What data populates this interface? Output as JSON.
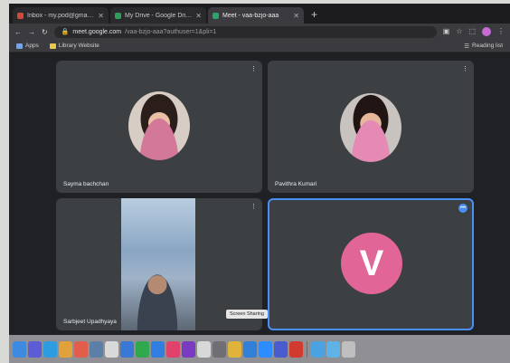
{
  "browser": {
    "tabs": [
      {
        "label": "Inbox - my.pod@gmail.com",
        "color": "#d14b3c",
        "active": false
      },
      {
        "label": "My Drive - Google Drive",
        "color": "#2f9e5b",
        "active": false
      },
      {
        "label": "Meet - vaa-bzjo-aaa",
        "color": "#2ba36a",
        "active": true
      }
    ],
    "new_tab_label": "+",
    "url": "meet.google.com",
    "url_rest": "/vaa-bzjo-aaa?authuser=1&pli=1",
    "bookmarks": [
      {
        "label": "Apps"
      },
      {
        "label": "Library Website"
      }
    ],
    "bookmarks_right": "Reading list"
  },
  "meet": {
    "accent": "#4a8ff5",
    "tiles": [
      {
        "name": "Sayma bachchan",
        "kind": "photo"
      },
      {
        "name": "Pavithra Kumari",
        "kind": "photo"
      },
      {
        "name": "Sarbjeet Upadhyaya",
        "kind": "video"
      },
      {
        "name": "",
        "kind": "initial",
        "initial": "V",
        "initial_color": "#e26597",
        "speaking": true
      }
    ],
    "tooltip": "Screen Sharing"
  },
  "dock": {
    "icons": [
      {
        "name": "finder-icon",
        "color": "#3d8be0"
      },
      {
        "name": "siri-icon",
        "color": "#5c5cd6"
      },
      {
        "name": "safari-icon",
        "color": "#2d9ce0"
      },
      {
        "name": "chrome-icon",
        "color": "#e0a13a"
      },
      {
        "name": "photos-icon",
        "color": "#e35d4b"
      },
      {
        "name": "notes-icon",
        "color": "#5b7fa8"
      },
      {
        "name": "launchpad-icon",
        "color": "#d9d9d9"
      },
      {
        "name": "mail-icon",
        "color": "#3a78d6"
      },
      {
        "name": "facetime-icon",
        "color": "#30a84d"
      },
      {
        "name": "appstore-icon",
        "color": "#2f7ee0"
      },
      {
        "name": "music-icon",
        "color": "#e0426c"
      },
      {
        "name": "onenote-icon",
        "color": "#7b3ac2"
      },
      {
        "name": "preview-icon",
        "color": "#d8d8d8"
      },
      {
        "name": "settings-icon",
        "color": "#6e6e73"
      },
      {
        "name": "chrome2-icon",
        "color": "#e0b33a"
      },
      {
        "name": "xcode-icon",
        "color": "#2f80d6"
      },
      {
        "name": "zoom-icon",
        "color": "#2d8cff"
      },
      {
        "name": "teams-icon",
        "color": "#4a5bcf"
      },
      {
        "name": "acrobat-icon",
        "color": "#d13a2f"
      },
      {
        "name": "folder-icon",
        "color": "#4aa3e0"
      },
      {
        "name": "downloads-icon",
        "color": "#5fb2e6"
      },
      {
        "name": "trash-icon",
        "color": "#bfbfbf"
      }
    ]
  }
}
